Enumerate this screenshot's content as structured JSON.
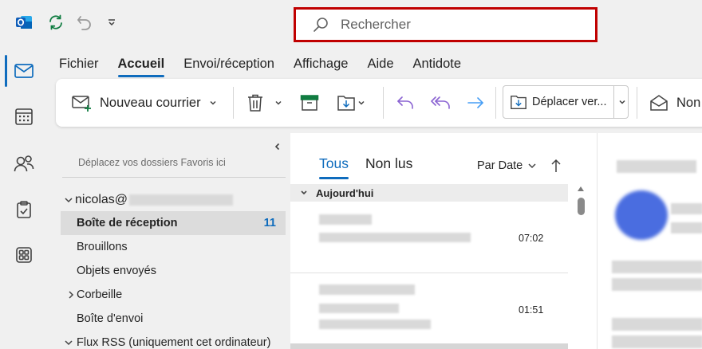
{
  "titlebar": {
    "search_placeholder": "Rechercher"
  },
  "menu": {
    "tabs": [
      "Fichier",
      "Accueil",
      "Envoi/réception",
      "Affichage",
      "Aide",
      "Antidote"
    ],
    "active_tab": "Accueil"
  },
  "ribbon": {
    "new_mail_label": "Nouveau courrier",
    "move_label": "Déplacer ver...",
    "unread_label": "Non"
  },
  "folders": {
    "favorites_hint": "Déplacez vos dossiers Favoris ici",
    "account_prefix": "nicolas@",
    "items": [
      {
        "label": "Boîte de réception",
        "count": "11",
        "selected": true
      },
      {
        "label": "Brouillons"
      },
      {
        "label": "Objets envoyés"
      },
      {
        "label": "Corbeille",
        "expandable": true
      },
      {
        "label": "Boîte d'envoi"
      },
      {
        "label": "Flux RSS (uniquement cet ordinateur)",
        "expandable": true
      }
    ]
  },
  "messages": {
    "tabs": [
      "Tous",
      "Non lus"
    ],
    "active_tab": "Tous",
    "sort_label": "Par Date",
    "group_label": "Aujourd'hui",
    "items": [
      {
        "time": "07:02"
      },
      {
        "time": "01:51"
      }
    ]
  },
  "colors": {
    "accent": "#0f6cbd",
    "search_border": "#c00000",
    "ribbon_purple": "#8a63d2",
    "ribbon_blue": "#479ef5",
    "archive_green": "#107c41"
  }
}
